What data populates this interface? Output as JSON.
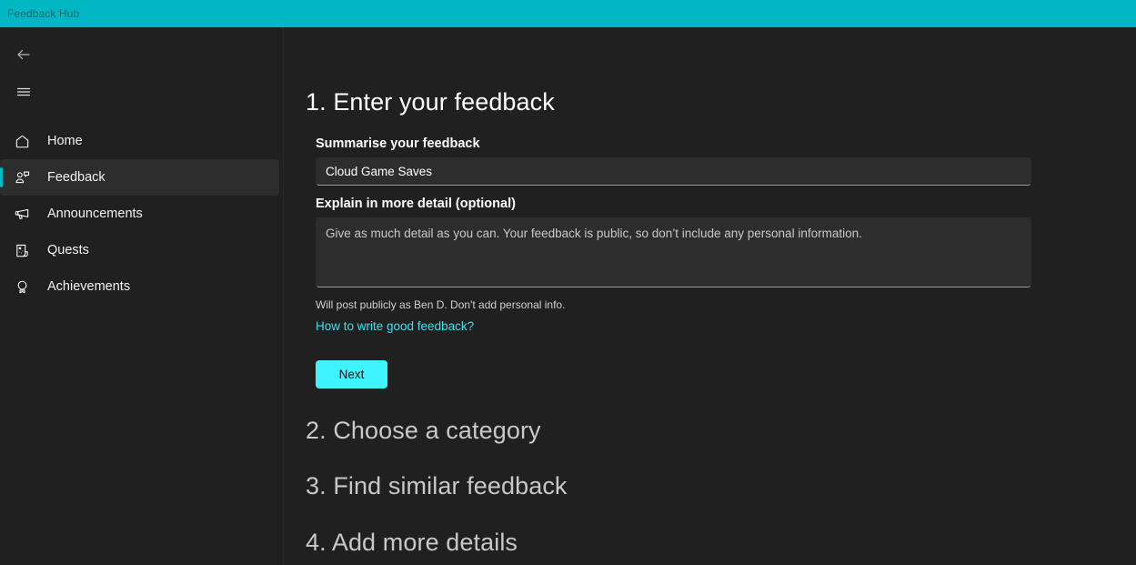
{
  "titlebar": {
    "title": "Feedback Hub"
  },
  "topnav": {
    "back_icon": "back-arrow-icon",
    "menu_icon": "hamburger-menu-icon"
  },
  "sidebar": {
    "items": [
      {
        "label": "Home",
        "icon": "home-icon",
        "selected": false
      },
      {
        "label": "Feedback",
        "icon": "feedback-icon",
        "selected": true
      },
      {
        "label": "Announcements",
        "icon": "megaphone-icon",
        "selected": false
      },
      {
        "label": "Quests",
        "icon": "scroll-icon",
        "selected": false
      },
      {
        "label": "Achievements",
        "icon": "ribbon-medal-icon",
        "selected": false
      }
    ]
  },
  "main": {
    "step1": {
      "heading": "1. Enter your feedback",
      "summary_label": "Summarise your feedback",
      "summary_value": "Cloud Game Saves",
      "summary_placeholder": "Summarise your feedback",
      "detail_label": "Explain in more detail (optional)",
      "detail_value": "",
      "detail_placeholder": "Give as much detail as you can. Your feedback is public, so don’t include any personal information.",
      "hint": "Will post publicly as Ben D. Don't add personal info.",
      "link": "How to write good feedback?",
      "next_label": "Next"
    },
    "step2_heading": "2. Choose a category",
    "step3_heading": "3. Find similar feedback",
    "step4_heading": "4. Add more details"
  },
  "colors": {
    "titlebar": "#00b7c3",
    "accent": "#00b7c3",
    "button": "#3df4ff",
    "link": "#3ae0ef",
    "background": "#202020",
    "field": "#2d2d2d"
  }
}
